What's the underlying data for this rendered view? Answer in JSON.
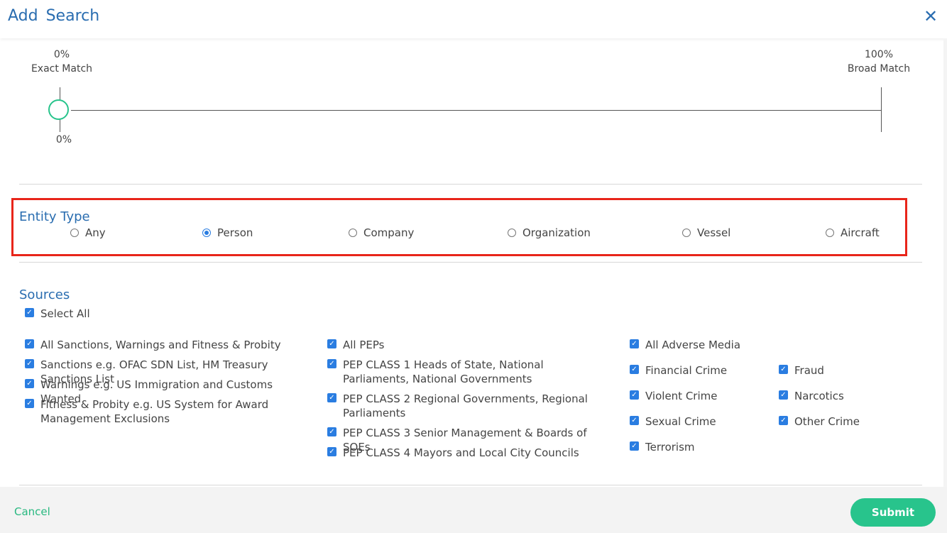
{
  "header": {
    "title": "Add Search",
    "close_glyph": "✕",
    "close_icon": "close-icon"
  },
  "slider": {
    "min_pct": "0%",
    "min_label": "Exact Match",
    "max_pct": "100%",
    "max_label": "Broad Match",
    "value_label": "0%",
    "value": 0
  },
  "entity_type": {
    "title": "Entity Type",
    "options": [
      {
        "label": "Any",
        "selected": false
      },
      {
        "label": "Person",
        "selected": true
      },
      {
        "label": "Company",
        "selected": false
      },
      {
        "label": "Organization",
        "selected": false
      },
      {
        "label": "Vessel",
        "selected": false
      },
      {
        "label": "Aircraft",
        "selected": false
      }
    ]
  },
  "sources": {
    "title": "Sources",
    "select_all": "Select All",
    "check_glyph": "✓",
    "col1": [
      "All Sanctions, Warnings and Fitness & Probity",
      "Sanctions e.g. OFAC SDN List, HM Treasury Sanctions List",
      "Warnings e.g. US Immigration and Customs Wanted",
      "Fitness & Probity e.g. US System for Award Management Exclusions"
    ],
    "col2": [
      "All PEPs",
      "PEP CLASS 1 Heads of State, National Parliaments, National Governments",
      "PEP CLASS 2 Regional Governments, Regional Parliaments",
      "PEP CLASS 3 Senior Management & Boards of SOEs",
      "PEP CLASS 4 Mayors and Local City Councils"
    ],
    "col3": [
      "All Adverse Media",
      "Financial Crime",
      "Violent Crime",
      "Sexual Crime",
      "Terrorism"
    ],
    "col4": [
      "Fraud",
      "Narcotics",
      "Other Crime"
    ]
  },
  "footer": {
    "cancel": "Cancel",
    "submit": "Submit"
  },
  "colors": {
    "accent_blue": "#2a6db0",
    "checkbox_blue": "#2a7de1",
    "green": "#28c48c",
    "highlight_red": "#e8251a"
  }
}
